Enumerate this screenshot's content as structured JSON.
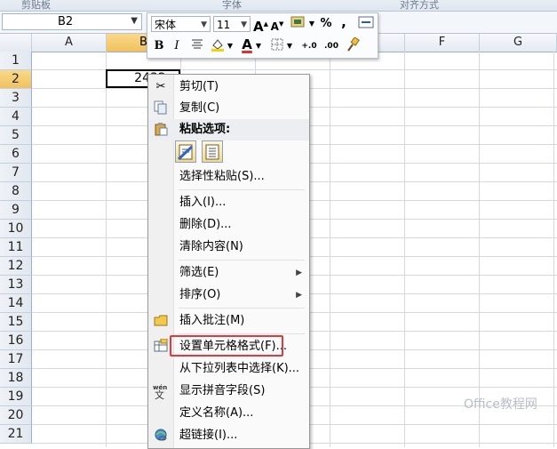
{
  "ribbon": {
    "group_labels": [
      "剪贴板",
      "字体",
      "对齐方式"
    ]
  },
  "name_box": {
    "value": "B2"
  },
  "columns": [
    "A",
    "B",
    "C",
    "D",
    "E",
    "F",
    "G"
  ],
  "selected_column": "B",
  "rows": [
    "1",
    "2",
    "3",
    "4",
    "5",
    "6",
    "7",
    "8",
    "9",
    "10",
    "11",
    "12",
    "13",
    "14",
    "15",
    "16",
    "17",
    "18",
    "19",
    "20",
    "21"
  ],
  "selected_row": "2",
  "cell_b2": {
    "value": "2432"
  },
  "mini_toolbar": {
    "font_name": "宋体",
    "font_size": "11",
    "grow_font": "A",
    "shrink_font": "A",
    "percent": "%",
    "comma": ",",
    "bold": "B",
    "italic": "I",
    "font_color_glyph": "A",
    "increase_decimal": "+.0",
    "decrease_decimal": ".00"
  },
  "context_menu": {
    "items": [
      {
        "label": "剪切(T)"
      },
      {
        "label": "复制(C)"
      },
      {
        "label": "粘贴选项:"
      },
      {
        "label": "选择性粘贴(S)..."
      },
      {
        "label": "插入(I)..."
      },
      {
        "label": "删除(D)..."
      },
      {
        "label": "清除内容(N)"
      },
      {
        "label": "筛选(E)"
      },
      {
        "label": "排序(O)"
      },
      {
        "label": "插入批注(M)"
      },
      {
        "label": "设置单元格格式(F)..."
      },
      {
        "label": "从下拉列表中选择(K)..."
      },
      {
        "label": "显示拼音字段(S)"
      },
      {
        "label": "定义名称(A)..."
      },
      {
        "label": "超链接(I)..."
      }
    ],
    "highlight_color": "#e0393e"
  },
  "icons": [
    "scissors-icon",
    "copy-icon",
    "paste-icon",
    "paste-values-icon",
    "paste-text-icon",
    "comment-icon",
    "format-cells-icon",
    "phonetic-icon",
    "hyperlink-icon"
  ],
  "watermark": "Office教程网"
}
